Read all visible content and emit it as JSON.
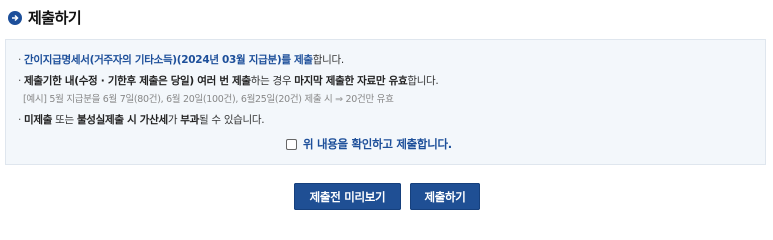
{
  "header": {
    "title": "제출하기",
    "icon": "arrow-right-circle-icon"
  },
  "notice": {
    "line1": {
      "bold": "간이지급명세서(거주자의 기타소득)(2024년 03월 지급분)를 제출",
      "rest": "합니다."
    },
    "line2": {
      "b1": "제출기한 내(수정 · 기한후 제출은 당일) 여러 번 제출",
      "t1": "하는 경우 ",
      "b2": "마지막 제출한 자료만 유효",
      "t2": "합니다."
    },
    "line3": "[예시] 5월 지급분을 6월 7일(80건), 6월 20일(100건), 6월25일(20건) 제출 시 ⇒ 20건만 유효",
    "line4": {
      "b1": "미제출",
      "t1": " 또는 ",
      "b2": "불성실제출 시 가산세",
      "t2": "가 ",
      "b3": "부과",
      "t3": "될 수 있습니다."
    },
    "confirm_label": "위 내용을 확인하고 제출합니다.",
    "confirm_checked": false
  },
  "buttons": {
    "preview": "제출전 미리보기",
    "submit": "제출하기"
  },
  "colors": {
    "accent": "#1d4f9a",
    "button": "#1f4f94",
    "box_bg": "#f3f7fb"
  }
}
